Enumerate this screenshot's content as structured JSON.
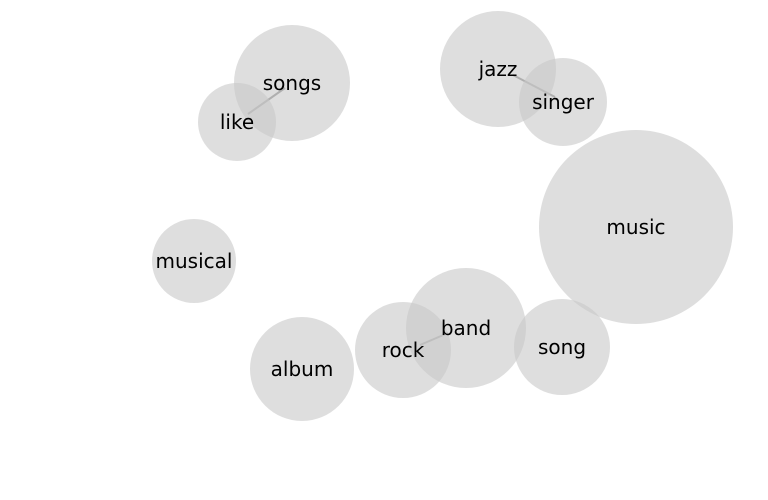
{
  "nodes": [
    {
      "id": "songs",
      "label": "songs"
    },
    {
      "id": "like",
      "label": "like"
    },
    {
      "id": "jazz",
      "label": "jazz"
    },
    {
      "id": "singer",
      "label": "singer"
    },
    {
      "id": "music",
      "label": "music"
    },
    {
      "id": "musical",
      "label": "musical"
    },
    {
      "id": "band",
      "label": "band"
    },
    {
      "id": "rock",
      "label": "rock"
    },
    {
      "id": "song",
      "label": "song"
    },
    {
      "id": "album",
      "label": "album"
    }
  ],
  "links": [
    {
      "source": "like",
      "target": "songs"
    },
    {
      "source": "jazz",
      "target": "singer"
    },
    {
      "source": "rock",
      "target": "band"
    }
  ],
  "colors": {
    "bubble": "#c8c8c8",
    "link": "#8a8a8a",
    "text": "#000000"
  }
}
